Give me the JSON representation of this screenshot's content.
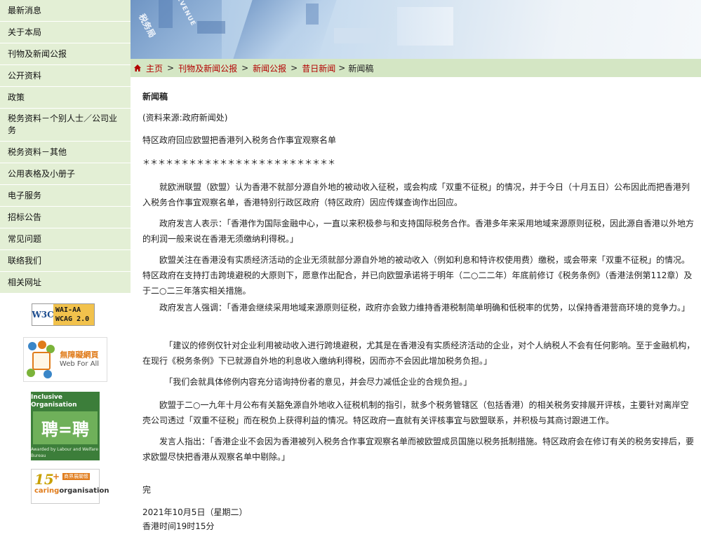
{
  "nav": {
    "items": [
      {
        "label": "最新消息"
      },
      {
        "label": "关于本局"
      },
      {
        "label": "刊物及新闻公报"
      },
      {
        "label": "公开资料"
      },
      {
        "label": "政策"
      },
      {
        "label": "税务资料－个别人士／公司业务"
      },
      {
        "label": "税务资料－其他"
      },
      {
        "label": "公用表格及小册子"
      },
      {
        "label": "电子服务"
      },
      {
        "label": "招标公告"
      },
      {
        "label": "常见问题"
      },
      {
        "label": "联络我们"
      },
      {
        "label": "相关网址"
      }
    ]
  },
  "badges": {
    "w3c": {
      "logo": "W3C",
      "line1": "WAI-AA",
      "line2": "WCAG 2.0"
    },
    "webforall": {
      "cn": "無障礙網頁",
      "en": "Web For All"
    },
    "inclusive": {
      "title1": "Inclusive Organisation",
      "mark": "聘=聘",
      "footer": "Awarded by Labour and Welfare Bureau"
    },
    "caring": {
      "years": "15",
      "plus": "+",
      "tag": "商界展關懷",
      "brand_a": "caring",
      "brand_b": "organisation"
    }
  },
  "banner": {
    "texts": [
      "REVENUE",
      "税务局"
    ]
  },
  "breadcrumb": {
    "home": "主页",
    "c1": "刊物及新闻公报",
    "c2": "新闻公报",
    "c3": "昔日新闻",
    "current": "新闻稿",
    "sep": ">"
  },
  "article": {
    "heading": "新闻稿",
    "source": "(资料来源:政府新闻处)",
    "title": "特区政府回应欧盟把香港列入税务合作事宜观察名单",
    "stars": "＊＊＊＊＊＊＊＊＊＊＊＊＊＊＊＊＊＊＊＊＊＊＊＊＊",
    "paragraphs": [
      "就欧洲联盟（欧盟）认为香港不就部分源自外地的被动收入征税，或会构成「双重不征税」的情况，并于今日（十月五日）公布因此而把香港列入税务合作事宜观察名单，香港特别行政区政府（特区政府）因应传媒查询作出回应。",
      "政府发言人表示：「香港作为国际金融中心，一直以来积极参与和支持国际税务合作。香港多年来采用地域来源原则征税，因此源自香港以外地方的利润一般来说在香港无须缴纳利得税。」",
      "欧盟关注在香港没有实质经济活动的企业无须就部分源自外地的被动收入（例如利息和特许权使用费）缴税，或会带来「双重不征税」的情况。特区政府在支持打击跨境避税的大原则下，愿意作出配合，并已向欧盟承诺将于明年（二○二二年）年底前修订《税务条例》（香港法例第112章）及于二○二三年落实相关措施。",
      "政府发言人强调：「香港会继续采用地域来源原则征税，政府亦会致力维持香港税制简单明确和低税率的优势，以保持香港营商环境的竞争力。」",
      "「建议的修例仅针对企业利用被动收入进行跨境避税，尤其是在香港没有实质经济活动的企业，对个人纳税人不会有任何影响。至于金融机构，在现行《税务条例》下已就源自外地的利息收入缴纳利得税，因而亦不会因此增加税务负担。」",
      "「我们会就具体修例内容充分谘询持份者的意见，并会尽力减低企业的合规负担。」",
      "欧盟于二○一九年十月公布有关豁免源自外地收入征税机制的指引，就多个税务管辖区（包括香港）的相关税务安排展开评核，主要针对离岸空壳公司透过「双重不征税」而在税负上获得利益的情况。特区政府一直就有关评核事宜与欧盟联系，并积极与其商讨跟进工作。",
      "发言人指出：「香港企业不会因为香港被列入税务合作事宜观察名单而被欧盟成员国施以税务抵制措施。特区政府会在修订有关的税务安排后，要求欧盟尽快把香港从观察名单中剔除。」"
    ],
    "end": "完",
    "date": "2021年10月5日（星期二）",
    "time": "香港时间19时15分"
  }
}
